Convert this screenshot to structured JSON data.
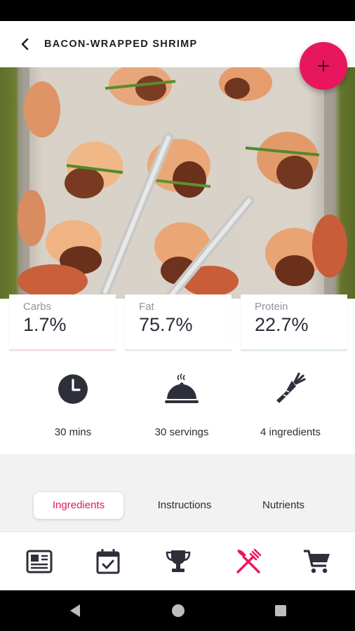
{
  "header": {
    "title": "BACON-WRAPPED SHRIMP",
    "back_icon": "arrow-back-icon",
    "fab_icon": "plus-icon"
  },
  "macros": [
    {
      "label": "Carbs",
      "value": "1.7%"
    },
    {
      "label": "Fat",
      "value": "75.7%"
    },
    {
      "label": "Protein",
      "value": "22.7%"
    }
  ],
  "stats": [
    {
      "icon": "clock-icon",
      "label": "30 mins"
    },
    {
      "icon": "serving-cloche-icon",
      "label": "30 servings"
    },
    {
      "icon": "carrot-icon",
      "label": "4 ingredients"
    }
  ],
  "tabs": [
    {
      "label": "Ingredients",
      "active": true
    },
    {
      "label": "Instructions",
      "active": false
    },
    {
      "label": "Nutrients",
      "active": false
    }
  ],
  "bottom_nav": [
    {
      "icon": "newspaper-icon",
      "active": false
    },
    {
      "icon": "calendar-check-icon",
      "active": false
    },
    {
      "icon": "trophy-icon",
      "active": false
    },
    {
      "icon": "fork-knife-icon",
      "active": true
    },
    {
      "icon": "cart-icon",
      "active": false
    }
  ],
  "system_nav": [
    "back-triangle-icon",
    "home-circle-icon",
    "recents-square-icon"
  ],
  "colors": {
    "accent": "#e8175d",
    "text_dark": "#2a2c36",
    "label_gray": "#8f949b",
    "tabs_background": "#f2f2f2"
  }
}
